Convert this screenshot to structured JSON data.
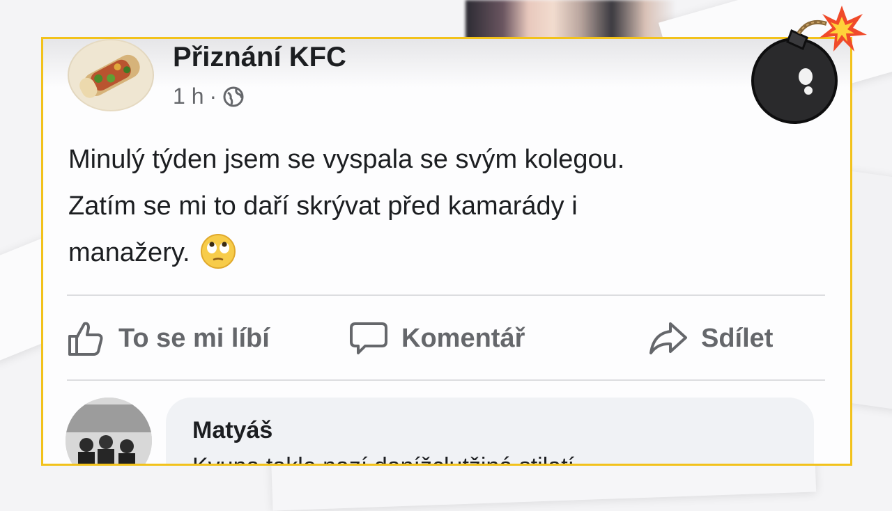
{
  "post": {
    "page_name": "Přiznání KFC",
    "time": "1 h",
    "separator": "·",
    "audience_icon": "globe-icon",
    "text_lines": [
      "Minulý týden jsem se vyspala se svým kolegou.",
      "Zatím se mi to daří skrývat před kamarády i",
      "manažery."
    ],
    "text_emoji": "face-with-rolling-eyes-emoji"
  },
  "actions": {
    "like_label": "To se mi líbí",
    "comment_label": "Komentář",
    "share_label": "Sdílet"
  },
  "comment": {
    "author": "Matyáš",
    "text": "Kvuna takle nazí danížclutžiná stilatí"
  },
  "colors": {
    "frame_border": "#f2c21b",
    "text": "#1c1e21",
    "muted": "#65676b",
    "bubble": "#f0f2f5"
  },
  "decoration": {
    "bomb_icon": "bomb-icon"
  }
}
